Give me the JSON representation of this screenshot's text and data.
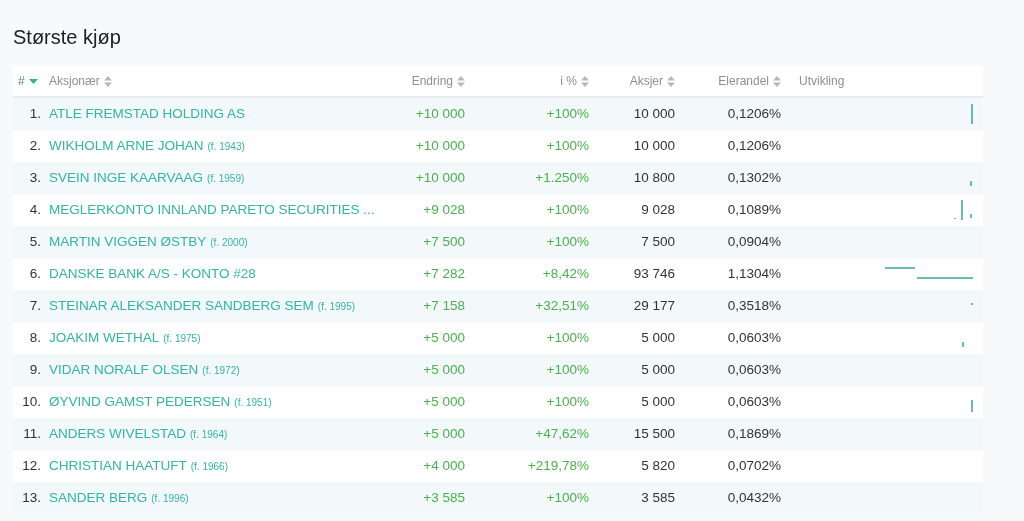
{
  "title": "Største kjøp",
  "columns": [
    {
      "label": "#",
      "sortable": true,
      "selected": true
    },
    {
      "label": "Aksjonær",
      "sortable": true,
      "selected": false
    },
    {
      "label": "Endring",
      "sortable": true,
      "selected": false
    },
    {
      "label": "i %",
      "sortable": true,
      "selected": false
    },
    {
      "label": "Aksjer",
      "sortable": true,
      "selected": false
    },
    {
      "label": "Elerandel",
      "sortable": true,
      "selected": false
    },
    {
      "label": "Utvikling",
      "sortable": false,
      "selected": false
    }
  ],
  "rows": [
    {
      "rank": "1.",
      "name": "ATLE FREMSTAD HOLDING AS",
      "change": "+10 000",
      "percent": "+100%",
      "shares": "10 000",
      "ownership": "0,1206%"
    },
    {
      "rank": "2.",
      "name": "WIKHOLM ARNE JOHAN",
      "born": "(f. 1943)",
      "change": "+10 000",
      "percent": "+100%",
      "shares": "10 000",
      "ownership": "0,1206%"
    },
    {
      "rank": "3.",
      "name": "SVEIN INGE KAARVAAG",
      "born": "(f. 1959)",
      "change": "+10 000",
      "percent": "+1.250%",
      "shares": "10 800",
      "ownership": "0,1302%"
    },
    {
      "rank": "4.",
      "name": "MEGLERKONTO INNLAND PARETO SECURITIES ...",
      "change": "+9 028",
      "percent": "+100%",
      "shares": "9 028",
      "ownership": "0,1089%"
    },
    {
      "rank": "5.",
      "name": "MARTIN VIGGEN ØSTBY",
      "born": "(f. 2000)",
      "change": "+7 500",
      "percent": "+100%",
      "shares": "7 500",
      "ownership": "0,0904%"
    },
    {
      "rank": "6.",
      "name": "DANSKE BANK A/S - KONTO #28",
      "change": "+7 282",
      "percent": "+8,42%",
      "shares": "93 746",
      "ownership": "1,1304%"
    },
    {
      "rank": "7.",
      "name": "STEINAR ALEKSANDER SANDBERG SEM",
      "born": "(f. 1995)",
      "change": "+7 158",
      "percent": "+32,51%",
      "shares": "29 177",
      "ownership": "0,3518%"
    },
    {
      "rank": "8.",
      "name": "JOAKIM WETHAL",
      "born": "(f. 1975)",
      "change": "+5 000",
      "percent": "+100%",
      "shares": "5 000",
      "ownership": "0,0603%"
    },
    {
      "rank": "9.",
      "name": "VIDAR NORALF OLSEN",
      "born": "(f. 1972)",
      "change": "+5 000",
      "percent": "+100%",
      "shares": "5 000",
      "ownership": "0,0603%"
    },
    {
      "rank": "10.",
      "name": "ØYVIND GAMST PEDERSEN",
      "born": "(f. 1951)",
      "change": "+5 000",
      "percent": "+100%",
      "shares": "5 000",
      "ownership": "0,0603%"
    },
    {
      "rank": "11.",
      "name": "ANDERS WIVELSTAD",
      "born": "(f. 1964)",
      "change": "+5 000",
      "percent": "+47,62%",
      "shares": "15 500",
      "ownership": "0,1869%"
    },
    {
      "rank": "12.",
      "name": "CHRISTIAN HAATUFT",
      "born": "(f. 1966)",
      "change": "+4 000",
      "percent": "+219,78%",
      "shares": "5 820",
      "ownership": "0,0702%"
    },
    {
      "rank": "13.",
      "name": "SANDER BERG",
      "born": "(f. 1996)",
      "change": "+3 585",
      "percent": "+100%",
      "shares": "3 585",
      "ownership": "0,0432%"
    }
  ]
}
